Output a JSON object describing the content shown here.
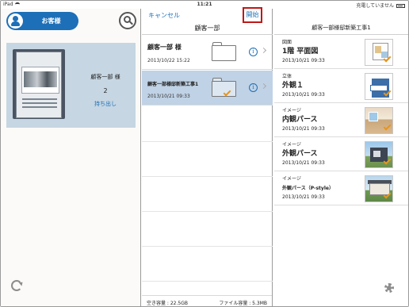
{
  "status": {
    "device": "iPad",
    "time": "11:21",
    "charging": "充電していません"
  },
  "pane1": {
    "customer_button": "お客様",
    "card": {
      "name": "顧客一部 様",
      "count": "2",
      "takeout": "持ち出し"
    }
  },
  "pane2": {
    "cancel": "キャンセル",
    "start": "開始",
    "title": "顧客一部",
    "rows": [
      {
        "name": "顧客一部 様",
        "date": "2013/10/22 15:22"
      },
      {
        "name": "顧客一部様邸新築工事1",
        "date": "2013/10/21 09:33"
      }
    ],
    "footer": {
      "free": "空き容量 : 22.5GB",
      "file_size": "ファイル容量 : 5.3MB"
    }
  },
  "pane3": {
    "title": "顧客一部様邸新築工事1",
    "docs": [
      {
        "category": "図面",
        "name": "1階 平面図",
        "date": "2013/10/21 09:33"
      },
      {
        "category": "立体",
        "name": "外観１",
        "date": "2013/10/21 09:33"
      },
      {
        "category": "イメージ",
        "name": "内観パース",
        "date": "2013/10/21 09:33"
      },
      {
        "category": "イメージ",
        "name": "外観パース",
        "date": "2013/10/21 09:33"
      },
      {
        "category": "イメージ",
        "name": "外観パース（P-style）",
        "date": "2013/10/21 09:33"
      }
    ]
  },
  "colors": {
    "accent": "#1d6fb8",
    "selected_row": "#c0d2e5",
    "check": "#e8951c",
    "highlight_border": "#c01818"
  }
}
